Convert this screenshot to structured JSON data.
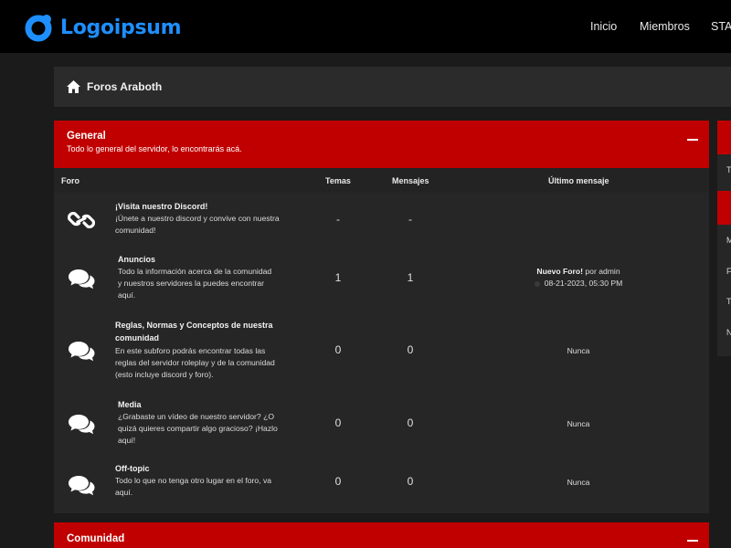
{
  "brand": {
    "name": "Logoipsum",
    "color": "#1e8fff"
  },
  "nav": {
    "home": "Inicio",
    "members": "Miembros",
    "staff": "STAFF"
  },
  "breadcrumb": {
    "label": "Foros Araboth"
  },
  "sections": [
    {
      "title": "General",
      "description": "Todo lo general del servidor, lo encontrarás acá.",
      "columns": {
        "forum": "Foro",
        "topics": "Temas",
        "posts": "Mensajes",
        "last_post": "Último mensaje"
      },
      "forums": [
        {
          "icon": "link-icon",
          "title": "¡Visita nuestro Discord!",
          "desc_lines": [
            "¡Únete a nuestro discord y convive con nuestra",
            "comunidad!"
          ],
          "topics": "-",
          "posts": "-",
          "last": ""
        },
        {
          "icon": "chat-bubbles-icon",
          "title": "Anuncios",
          "desc_lines": [
            "Todo la información acerca de la comunidad",
            "y nuestros servidores la puedes encontrar",
            "aquí."
          ],
          "topics": "1",
          "posts": "1",
          "last_title": "Nuevo Foro!",
          "last_by": " por admin",
          "last_date": "08-21-2023, 05:30 PM"
        },
        {
          "icon": "chat-bubbles-icon",
          "title_lines": [
            "Reglas, Normas y Conceptos de nuestra",
            "comunidad"
          ],
          "desc_lines": [
            "En este subforo podrás encontrar todas las",
            "reglas del servidor roleplay y de la comunidad",
            "(esto incluye discord y foro)."
          ],
          "topics": "0",
          "posts": "0",
          "last": "Nunca"
        },
        {
          "icon": "chat-bubbles-icon",
          "title": "Media",
          "desc_lines": [
            "¿Grabaste un vídeo de nuestro servidor? ¿O",
            "quizá quieres compartir algo gracioso? ¡Hazlo",
            "aquí!"
          ],
          "topics": "0",
          "posts": "0",
          "last": "Nunca"
        },
        {
          "icon": "chat-bubbles-icon",
          "title": "Off-topic",
          "desc_lines": [
            "Todo lo que no tenga otro lugar en el foro, va",
            "aquí."
          ],
          "topics": "0",
          "posts": "0",
          "last": "Nunca"
        }
      ]
    },
    {
      "title": "Comunidad"
    }
  ],
  "sidebar_fragments": {
    "a": "T",
    "b": "M",
    "c": "F",
    "d": "T",
    "e": "N"
  },
  "colors": {
    "accent": "#c00000",
    "topbar": "#000000",
    "background": "#1b1b1b"
  }
}
